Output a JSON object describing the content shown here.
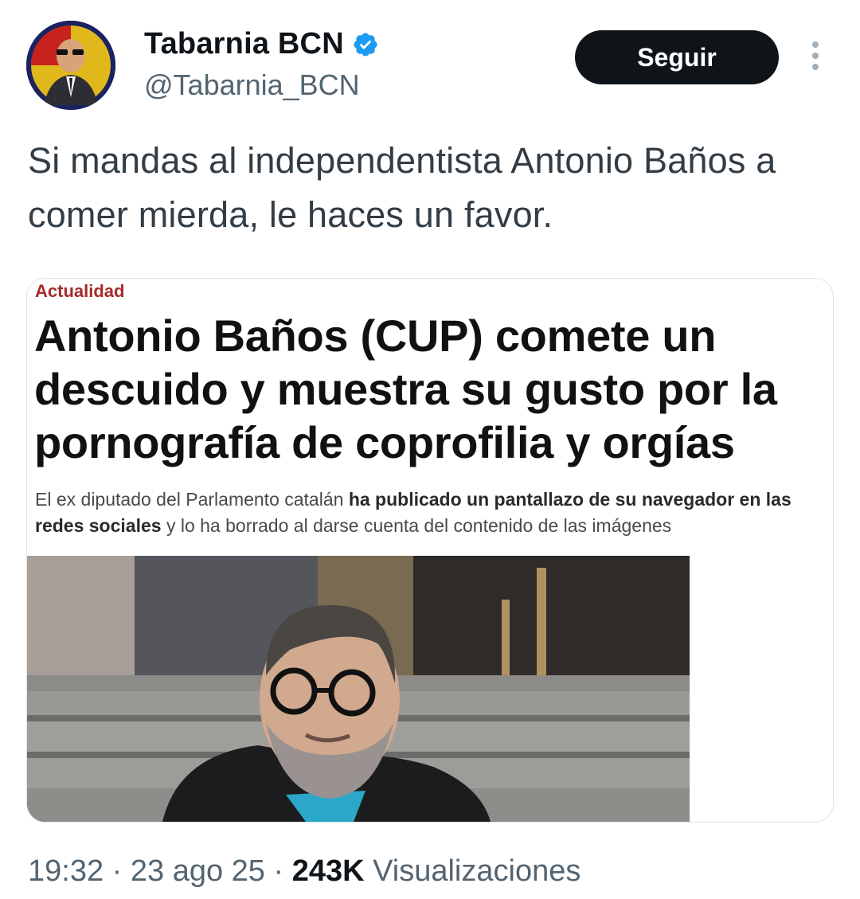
{
  "user": {
    "display_name": "Tabarnia BCN",
    "handle": "@Tabarnia_BCN",
    "verified_icon": "verified-badge-icon",
    "verified_color": "#1d9bf0"
  },
  "actions": {
    "follow_label": "Seguir",
    "more_icon": "more-vertical-icon"
  },
  "tweet": {
    "text": "Si mandas al independentista Antonio Baños a comer mierda, le haces un favor."
  },
  "media": {
    "section_label": "Actualidad",
    "headline": "Antonio Baños (CUP) comete un descuido y muestra su gusto por la pornografía de coprofilia y orgías",
    "subhead_part1": "El ex diputado del Parlamento catalán ",
    "subhead_bold": "ha publicado un pantallazo de su navegador en las redes sociales",
    "subhead_part2": " y lo ha borrado al darse cuenta del contenido de las imágenes",
    "label_color": "#a52a2a"
  },
  "meta": {
    "time": "19:32",
    "separator": " · ",
    "date": "23 ago 25",
    "views_count": "243K",
    "views_label": " Visualizaciones"
  }
}
